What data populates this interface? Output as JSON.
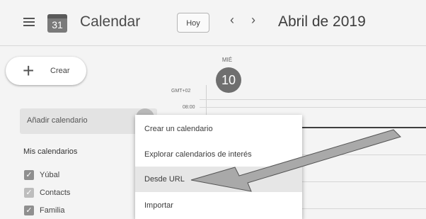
{
  "header": {
    "menu_icon": "hamburger-menu-icon",
    "logo_day": "31",
    "app_title": "Calendar",
    "today_label": "Hoy",
    "prev_icon": "chevron-left-icon",
    "prev_glyph": "‹",
    "next_icon": "chevron-right-icon",
    "next_glyph": "›",
    "month_label": "Abril de 2019"
  },
  "sidebar": {
    "create_label": "Crear",
    "create_glyph": "+",
    "add_calendar_label": "Añadir calendario",
    "my_calendars_title": "Mis calendarios",
    "calendars": [
      {
        "name": "Yúbal",
        "checked": true
      },
      {
        "name": "Contacts",
        "checked": true
      },
      {
        "name": "Familia",
        "checked": true
      }
    ]
  },
  "day_view": {
    "day_name": "MIÉ",
    "day_number": "10",
    "timezone": "GMT+02",
    "first_hour": "08:00"
  },
  "menu": {
    "items": [
      {
        "label": "Crear un calendario"
      },
      {
        "label": "Explorar calendarios de interés"
      },
      {
        "label": "Desde URL",
        "highlighted": true
      },
      {
        "label": "Importar"
      }
    ]
  },
  "annotation": {
    "arrow_color": "#a9a9a9",
    "arrow_target": "Desde URL"
  }
}
